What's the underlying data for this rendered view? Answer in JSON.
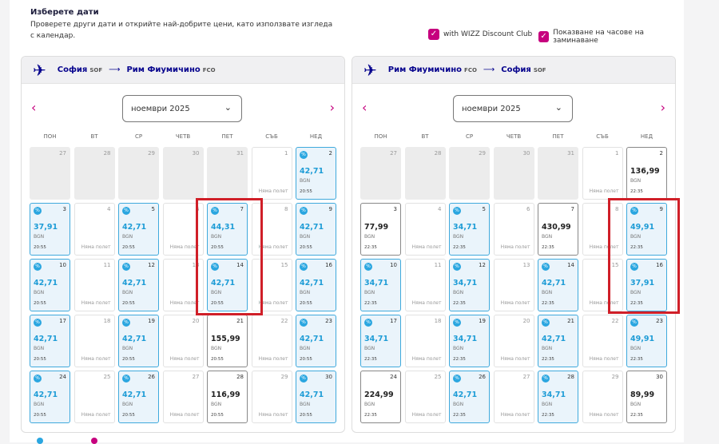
{
  "header": {
    "title": "Изберете дати",
    "subtitle": "Проверете други дати и открийте най-добрите цени, като използвате изгледа с календар.",
    "options": [
      {
        "label": "with WIZZ Discount Club",
        "checked": true
      },
      {
        "label": "Показване на часове на заминаване",
        "checked": true
      }
    ]
  },
  "weekdays": [
    "ПОН",
    "ВТ",
    "СР",
    "ЧЕТВ",
    "ПЕТ",
    "СЪБ",
    "НЕД"
  ],
  "calendars": [
    {
      "from": "София",
      "from_code": "SOF",
      "to": "Рим Фиумичино",
      "to_code": "FCO",
      "month": "ноември 2025",
      "days": [
        {
          "d": "27",
          "state": "past"
        },
        {
          "d": "28",
          "state": "past"
        },
        {
          "d": "29",
          "state": "past"
        },
        {
          "d": "30",
          "state": "past"
        },
        {
          "d": "31",
          "state": "past"
        },
        {
          "d": "1",
          "state": "none",
          "note": "Няма полет"
        },
        {
          "d": "2",
          "state": "disc",
          "price": "42,71",
          "cur": "BGN",
          "time": "20:55"
        },
        {
          "d": "3",
          "state": "disc",
          "price": "37,91",
          "cur": "BGN",
          "time": "20:55"
        },
        {
          "d": "4",
          "state": "none",
          "note": "Няма полет"
        },
        {
          "d": "5",
          "state": "disc",
          "price": "42,71",
          "cur": "BGN",
          "time": "20:55"
        },
        {
          "d": "6",
          "state": "none",
          "note": "Няма полет"
        },
        {
          "d": "7",
          "state": "disc",
          "price": "44,31",
          "cur": "BGN",
          "time": "20:55"
        },
        {
          "d": "8",
          "state": "none",
          "note": "Няма полет"
        },
        {
          "d": "9",
          "state": "disc",
          "price": "42,71",
          "cur": "BGN",
          "time": "20:55"
        },
        {
          "d": "10",
          "state": "disc",
          "price": "42,71",
          "cur": "BGN",
          "time": "20:55"
        },
        {
          "d": "11",
          "state": "none",
          "note": "Няма полет"
        },
        {
          "d": "12",
          "state": "disc",
          "price": "42,71",
          "cur": "BGN",
          "time": "20:55"
        },
        {
          "d": "13",
          "state": "none",
          "note": "Няма полет"
        },
        {
          "d": "14",
          "state": "disc",
          "price": "42,71",
          "cur": "BGN",
          "time": "20:55"
        },
        {
          "d": "15",
          "state": "none",
          "note": "Няма полет"
        },
        {
          "d": "16",
          "state": "disc",
          "price": "42,71",
          "cur": "BGN",
          "time": "20:55"
        },
        {
          "d": "17",
          "state": "disc",
          "price": "42,71",
          "cur": "BGN",
          "time": "20:55"
        },
        {
          "d": "18",
          "state": "none",
          "note": "Няма полет"
        },
        {
          "d": "19",
          "state": "disc",
          "price": "42,71",
          "cur": "BGN",
          "time": "20:55"
        },
        {
          "d": "20",
          "state": "none",
          "note": "Няма полет"
        },
        {
          "d": "21",
          "state": "price",
          "price": "155,99",
          "cur": "BGN",
          "time": "20:55"
        },
        {
          "d": "22",
          "state": "none",
          "note": "Няма полет"
        },
        {
          "d": "23",
          "state": "disc",
          "price": "42,71",
          "cur": "BGN",
          "time": "20:55"
        },
        {
          "d": "24",
          "state": "disc",
          "price": "42,71",
          "cur": "BGN",
          "time": "20:55"
        },
        {
          "d": "25",
          "state": "none",
          "note": "Няма полет"
        },
        {
          "d": "26",
          "state": "disc",
          "price": "42,71",
          "cur": "BGN",
          "time": "20:55"
        },
        {
          "d": "27",
          "state": "none",
          "note": "Няма полет"
        },
        {
          "d": "28",
          "state": "price",
          "price": "116,99",
          "cur": "BGN",
          "time": "20:55"
        },
        {
          "d": "29",
          "state": "none",
          "note": "Няма полет"
        },
        {
          "d": "30",
          "state": "disc",
          "price": "42,71",
          "cur": "BGN",
          "time": "20:55"
        }
      ]
    },
    {
      "from": "Рим Фиумичино",
      "from_code": "FCO",
      "to": "София",
      "to_code": "SOF",
      "month": "ноември 2025",
      "days": [
        {
          "d": "27",
          "state": "past"
        },
        {
          "d": "28",
          "state": "past"
        },
        {
          "d": "29",
          "state": "past"
        },
        {
          "d": "30",
          "state": "past"
        },
        {
          "d": "31",
          "state": "past"
        },
        {
          "d": "1",
          "state": "none",
          "note": "Няма полет"
        },
        {
          "d": "2",
          "state": "price",
          "price": "136,99",
          "cur": "BGN",
          "time": "22:35"
        },
        {
          "d": "3",
          "state": "price",
          "price": "77,99",
          "cur": "BGN",
          "time": "22:35"
        },
        {
          "d": "4",
          "state": "none",
          "note": "Няма полет"
        },
        {
          "d": "5",
          "state": "disc",
          "price": "34,71",
          "cur": "BGN",
          "time": "22:35"
        },
        {
          "d": "6",
          "state": "none",
          "note": "Няма полет"
        },
        {
          "d": "7",
          "state": "price",
          "price": "430,99",
          "cur": "BGN",
          "time": "22:35"
        },
        {
          "d": "8",
          "state": "none",
          "note": "Няма полет"
        },
        {
          "d": "9",
          "state": "disc",
          "price": "49,91",
          "cur": "BGN",
          "time": "22:35"
        },
        {
          "d": "10",
          "state": "disc",
          "price": "34,71",
          "cur": "BGN",
          "time": "22:35"
        },
        {
          "d": "11",
          "state": "none",
          "note": "Няма полет"
        },
        {
          "d": "12",
          "state": "disc",
          "price": "34,71",
          "cur": "BGN",
          "time": "22:35"
        },
        {
          "d": "13",
          "state": "none",
          "note": "Няма полет"
        },
        {
          "d": "14",
          "state": "disc",
          "price": "42,71",
          "cur": "BGN",
          "time": "22:35"
        },
        {
          "d": "15",
          "state": "none",
          "note": "Няма полет"
        },
        {
          "d": "16",
          "state": "disc",
          "price": "37,91",
          "cur": "BGN",
          "time": "22:35"
        },
        {
          "d": "17",
          "state": "disc",
          "price": "34,71",
          "cur": "BGN",
          "time": "22:35"
        },
        {
          "d": "18",
          "state": "none",
          "note": "Няма полет"
        },
        {
          "d": "19",
          "state": "disc",
          "price": "34,71",
          "cur": "BGN",
          "time": "22:35"
        },
        {
          "d": "20",
          "state": "none",
          "note": "Няма полет"
        },
        {
          "d": "21",
          "state": "disc",
          "price": "42,71",
          "cur": "BGN",
          "time": "22:35"
        },
        {
          "d": "22",
          "state": "none",
          "note": "Няма полет"
        },
        {
          "d": "23",
          "state": "disc",
          "price": "49,91",
          "cur": "BGN",
          "time": "22:35"
        },
        {
          "d": "24",
          "state": "price",
          "price": "224,99",
          "cur": "BGN",
          "time": "22:35"
        },
        {
          "d": "25",
          "state": "none",
          "note": "Няма полет"
        },
        {
          "d": "26",
          "state": "disc",
          "price": "42,71",
          "cur": "BGN",
          "time": "22:35"
        },
        {
          "d": "27",
          "state": "none",
          "note": "Няма полет"
        },
        {
          "d": "28",
          "state": "disc",
          "price": "34,71",
          "cur": "BGN",
          "time": "22:35"
        },
        {
          "d": "29",
          "state": "none",
          "note": "Няма полет"
        },
        {
          "d": "30",
          "state": "price",
          "price": "89,99",
          "cur": "BGN",
          "time": "22:35"
        }
      ]
    }
  ],
  "icons": {
    "plane": "plane-icon",
    "discount_badge": "discount-badge-icon",
    "prev": "chevron-left-icon",
    "next": "chevron-right-icon"
  },
  "colors": {
    "brand_navy": "#06038d",
    "brand_magenta": "#c6007e",
    "discount_blue": "#2aa6e0",
    "highlight_red": "#d01f28"
  }
}
